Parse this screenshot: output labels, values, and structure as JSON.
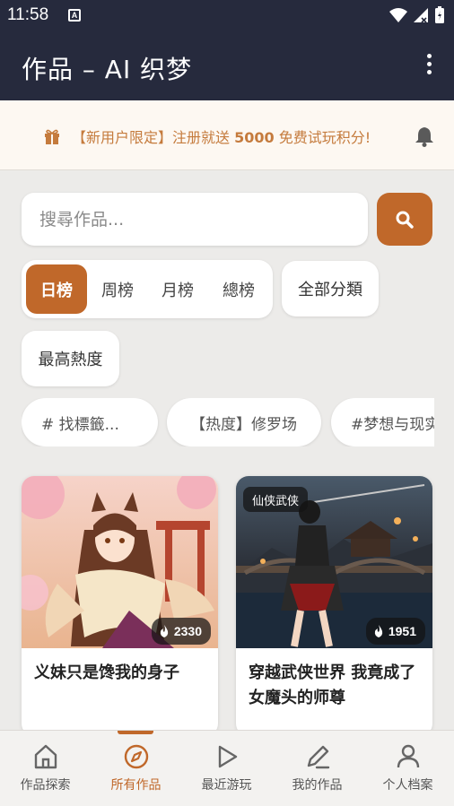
{
  "status_bar": {
    "time": "11:58",
    "app_icon_letter": "A"
  },
  "app_bar": {
    "title": "作品 – AI 织梦",
    "menu_icon": "more-vert-icon"
  },
  "banner": {
    "text_prefix": "【新用户限定】注册就送 ",
    "text_amount": "5000",
    "text_suffix": " 免费试玩积分!",
    "color": "#c57b3d"
  },
  "search": {
    "placeholder": "搜尋作品...",
    "value": "",
    "button_icon": "search-icon"
  },
  "rankings": {
    "items": [
      "日榜",
      "周榜",
      "月榜",
      "總榜"
    ],
    "selected": "日榜"
  },
  "filters": {
    "category": "全部分類",
    "sort": "最高熱度"
  },
  "tags": {
    "search_placeholder": "# 找標籤...",
    "items": [
      "【热度】修罗场",
      "#梦想与现实"
    ]
  },
  "cards": [
    {
      "title": "义妹只是馋我的身子",
      "views": "2330",
      "genre": ""
    },
    {
      "title": "穿越武侠世界 我竟成了女魔头的师尊",
      "views": "1951",
      "genre": "仙侠武侠"
    }
  ],
  "bottom_nav": {
    "items": [
      {
        "label": "作品探索",
        "icon": "home-icon"
      },
      {
        "label": "所有作品",
        "icon": "compass-icon"
      },
      {
        "label": "最近游玩",
        "icon": "play-icon"
      },
      {
        "label": "我的作品",
        "icon": "pencil-icon"
      },
      {
        "label": "个人档案",
        "icon": "person-icon"
      }
    ],
    "active": "所有作品"
  },
  "colors": {
    "accent": "#c0682a",
    "header_bg": "#262a3d",
    "page_bg": "#ecebe9"
  }
}
